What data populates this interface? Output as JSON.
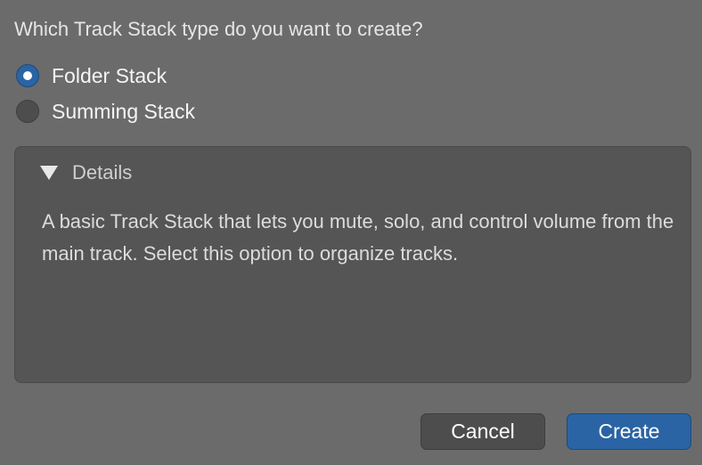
{
  "dialog": {
    "question": "Which Track Stack type do you want to create?",
    "options": [
      {
        "label": "Folder Stack",
        "selected": true
      },
      {
        "label": "Summing Stack",
        "selected": false
      }
    ],
    "details": {
      "label": "Details",
      "expanded": true,
      "description": "A basic Track Stack that lets you mute, solo, and control volume from the main track. Select this option to organize tracks."
    },
    "buttons": {
      "cancel": "Cancel",
      "create": "Create"
    },
    "colors": {
      "accent": "#2a64a4",
      "background": "#6b6b6b",
      "panel": "#555555"
    }
  }
}
